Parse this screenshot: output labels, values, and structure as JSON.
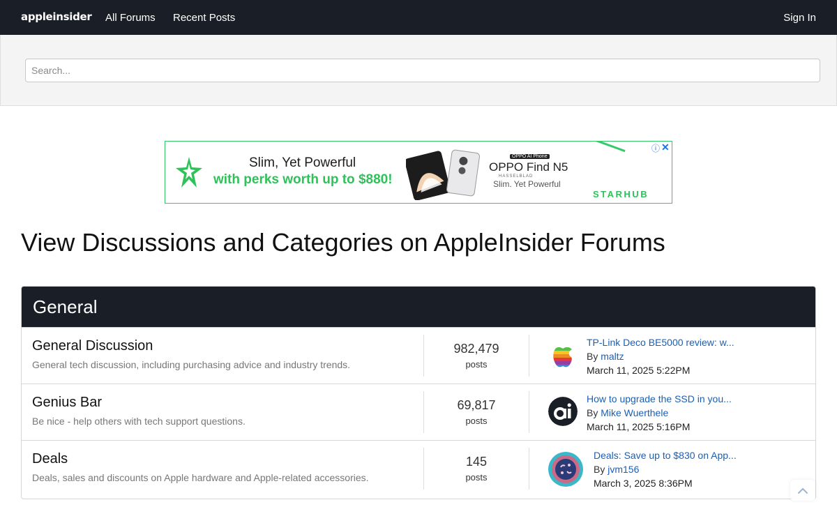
{
  "header": {
    "logo": "appleinsider",
    "nav": [
      "All Forums",
      "Recent Posts"
    ],
    "sign_in": "Sign In"
  },
  "search": {
    "placeholder": "Search..."
  },
  "ad": {
    "line1": "Slim, Yet Powerful",
    "line2": "with perks worth up to $880!",
    "badge": "OPPO AI Phone",
    "model": "OPPO Find N5",
    "hasselblad": "HASSELBLAD",
    "tagline": "Slim. Yet Powerful",
    "brand": "STARHUB",
    "colors": {
      "green": "#2fc15a",
      "info": "#1a73e8"
    }
  },
  "page_title": "View Discussions and Categories on AppleInsider Forums",
  "category": {
    "name": "General",
    "forums": [
      {
        "title": "General Discussion",
        "description": "General tech discussion, including purchasing advice and industry trends.",
        "count": "982,479",
        "count_label": "posts",
        "last_post": {
          "title": "TP-Link Deco BE5000 review: w...",
          "by_prefix": "By ",
          "author": "maltz",
          "date": "March 11, 2025 5:22PM",
          "avatar": "apple-rainbow-icon"
        }
      },
      {
        "title": "Genius Bar",
        "description": "Be nice - help others with tech support questions.",
        "count": "69,817",
        "count_label": "posts",
        "last_post": {
          "title": "How to upgrade the SSD in you...",
          "by_prefix": "By ",
          "author": "Mike Wuerthele",
          "date": "March 11, 2025 5:16PM",
          "avatar": "ai-logo-icon"
        }
      },
      {
        "title": "Deals",
        "description": "Deals, sales and discounts on Apple hardware and Apple-related accessories.",
        "count": "145",
        "count_label": "posts",
        "last_post": {
          "title": "Deals: Save up to $830 on App...",
          "by_prefix": "By ",
          "author": "jvm156",
          "date": "March 3, 2025 8:36PM",
          "avatar": "user-avatar-icon"
        }
      }
    ]
  },
  "colors": {
    "navbar": "#1a1e26",
    "link": "#1a5fb4"
  }
}
